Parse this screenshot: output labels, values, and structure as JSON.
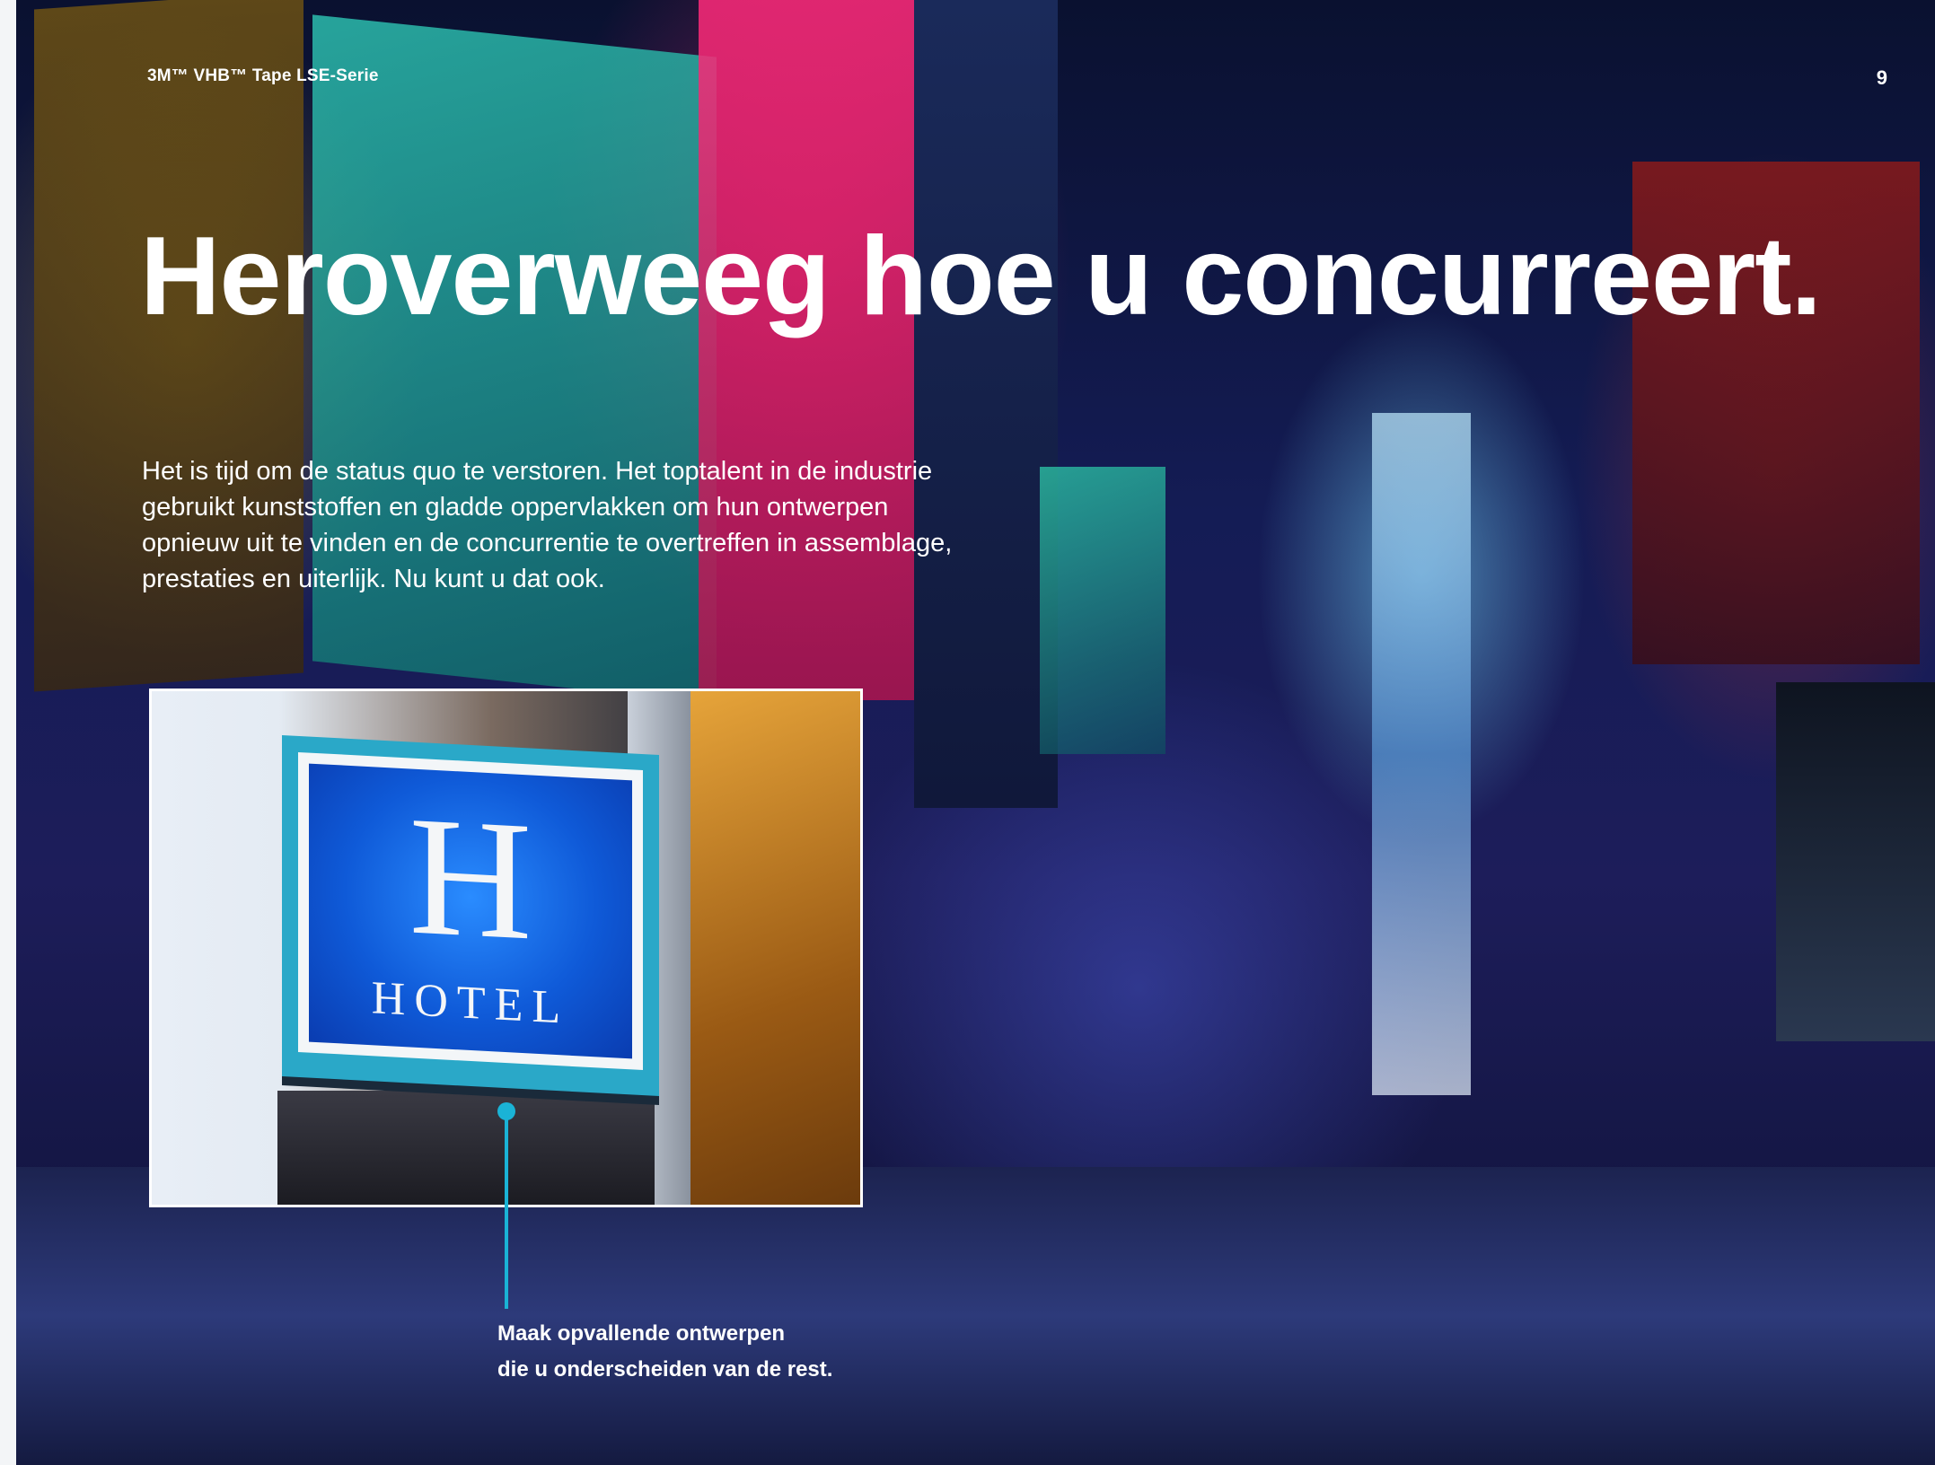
{
  "header": {
    "series_label": "3M™ VHB™ Tape LSE-Serie",
    "page_number": "9"
  },
  "main": {
    "headline": "Heroverweeg hoe u concurreert.",
    "intro": "Het is tijd om de status quo te verstoren. Het toptalent in de industrie gebruikt kunststoffen en gladde oppervlakken om hun ontwerpen opnieuw uit te vinden en de concurrentie te overtreffen in assemblage, prestaties en uiterlijk. Nu kunt u dat ook."
  },
  "inset_photo": {
    "sign_letter": "H",
    "sign_word": "HOTEL"
  },
  "callout": {
    "caption_line1": "Maak opvallende ontwerpen",
    "caption_line2": "die u onderscheiden van de rest."
  },
  "colors": {
    "accent": "#1ab3d6",
    "text": "#ffffff"
  }
}
